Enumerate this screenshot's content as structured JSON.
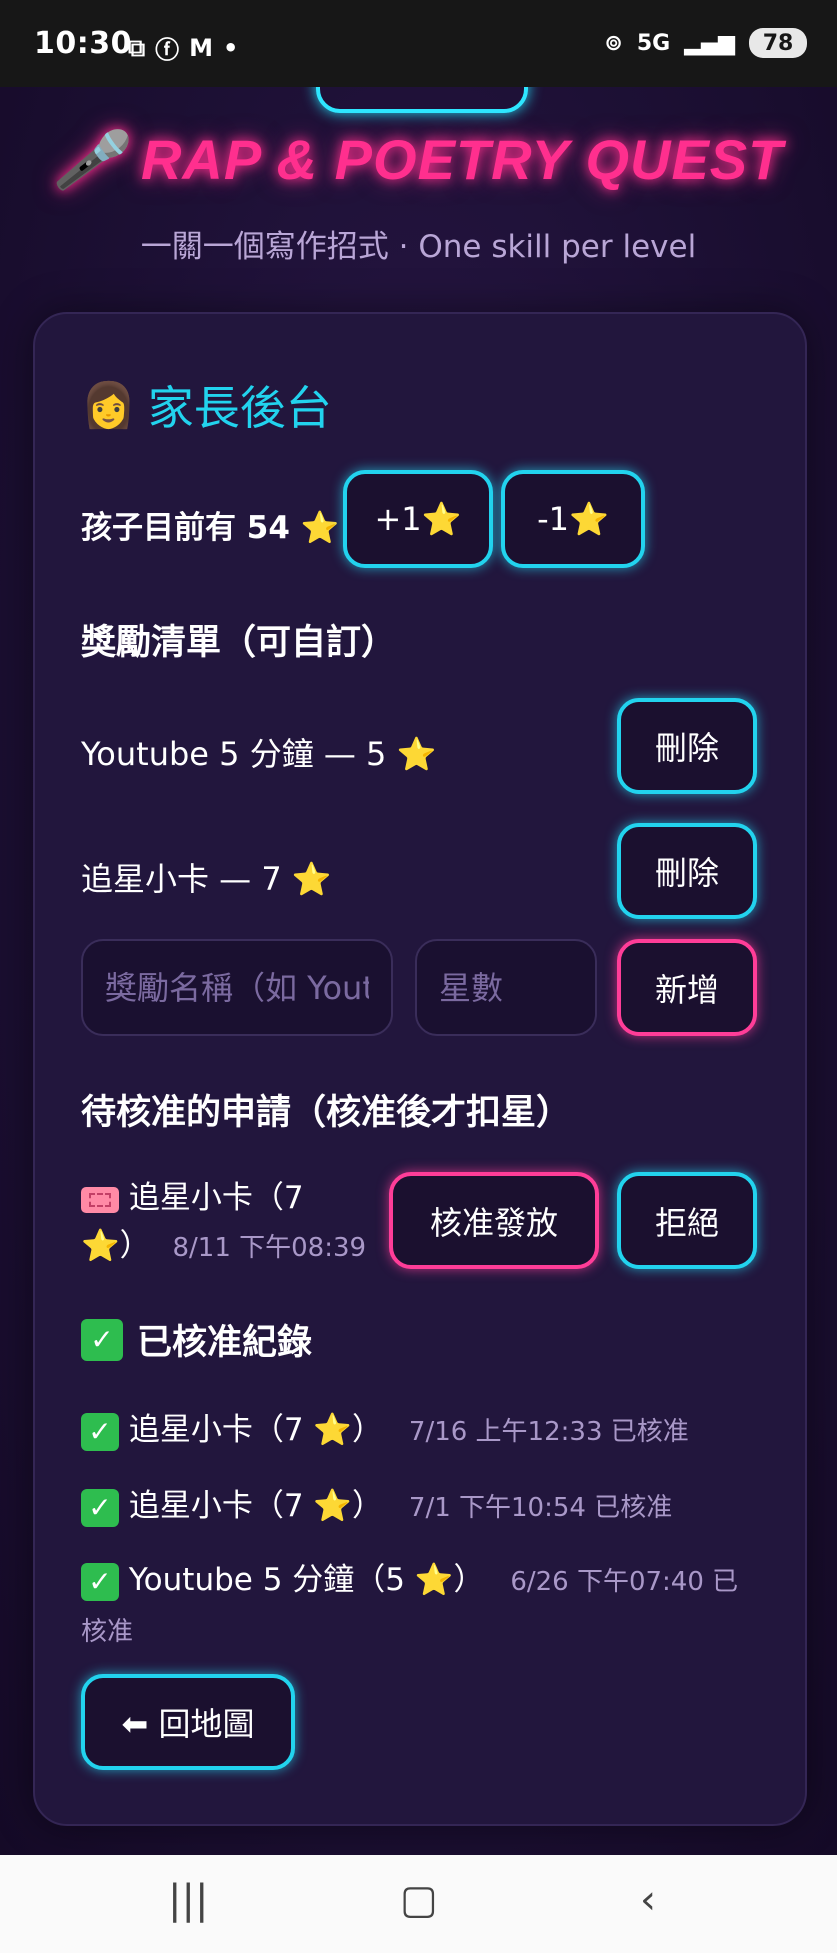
{
  "status_bar": {
    "time": "10:30",
    "left_icons": [
      "screenshot-icon",
      "facebook-icon",
      "gmail-icon",
      "dot-icon"
    ],
    "network": "5G",
    "battery": "78"
  },
  "header": {
    "title_emoji": "🎤",
    "title": "RAP & POETRY QUEST",
    "subtitle": "一關一個寫作招式 · One skill per level"
  },
  "panel": {
    "emoji": "👩",
    "title": "家長後台",
    "stars_label": "孩子目前有 54 ⭐",
    "plus_label": "+1⭐",
    "minus_label": "-1⭐"
  },
  "rewards": {
    "heading": "獎勵清單（可自訂）",
    "items": [
      {
        "label": "Youtube 5 分鐘 — 5 ⭐",
        "delete_label": "刪除"
      },
      {
        "label": "追星小卡 — 7 ⭐",
        "delete_label": "刪除"
      }
    ],
    "name_placeholder": "獎勵名稱（如 Youtube）",
    "stars_placeholder": "星數",
    "add_label": "新增"
  },
  "pending": {
    "heading": "待核准的申請（核准後才扣星）",
    "items": [
      {
        "label_line1": "追星小卡（7",
        "label_line2": "⭐）",
        "timestamp": "8/11 下午08:39",
        "approve_label": "核准發放",
        "reject_label": "拒絕"
      }
    ]
  },
  "approved": {
    "heading": "已核准紀錄",
    "items": [
      {
        "label": "追星小卡（7 ⭐）",
        "meta": "7/16 上午12:33 已核准"
      },
      {
        "label": "追星小卡（7 ⭐）",
        "meta": "7/1 下午10:54 已核准"
      },
      {
        "label": "Youtube 5 分鐘（5 ⭐）",
        "meta": "6/26 下午07:40 已核准"
      }
    ]
  },
  "back_button": {
    "label": "⬅ 回地圖"
  },
  "colors": {
    "cyan": "#22d3ee",
    "pink": "#ff3d98",
    "background": "#1b0f30",
    "card": "#22163d"
  }
}
